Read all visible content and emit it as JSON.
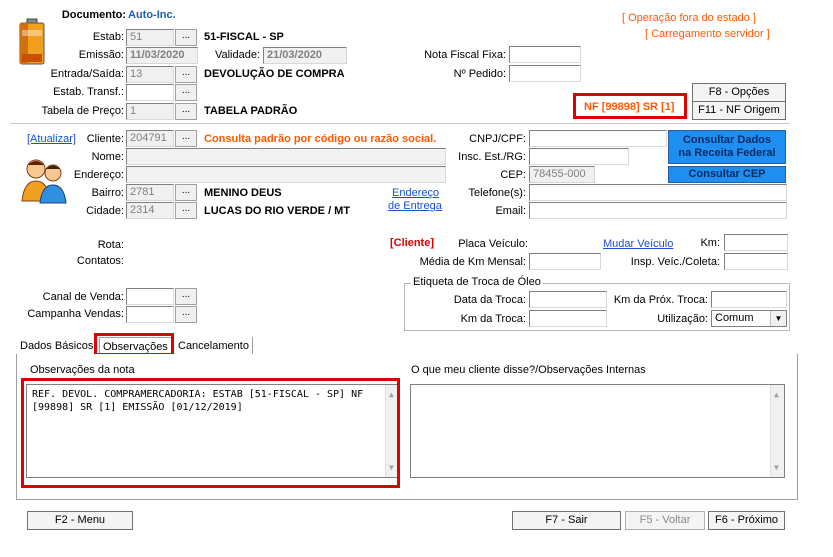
{
  "header": {
    "documento_label": "Documento:",
    "documento_value": "Auto-Inc.",
    "status_1": "[ Operação fora do estado ]",
    "status_2": "[ Carregamento servidor ]",
    "estab_label": "Estab:",
    "estab_value": "51",
    "estab_desc": "51-FISCAL - SP",
    "emissao_label": "Emissão:",
    "emissao_value": "11/03/2020",
    "validade_label": "Validade:",
    "validade_value": "21/03/2020",
    "entrada_label": "Entrada/Saída:",
    "entrada_value": "13",
    "entrada_desc": "DEVOLUÇÃO DE COMPRA",
    "estab_transf_label": "Estab. Transf.:",
    "tabela_label": "Tabela de Preço:",
    "tabela_value": "1",
    "tabela_desc": "TABELA PADRÃO",
    "nf_fixa_label": "Nota Fiscal Fixa:",
    "pedido_label": "Nº Pedido:",
    "nf_ref": "NF [99898] SR [1]",
    "f8_btn": "F8 - Opções",
    "f11_btn": "F11 - NF Origem",
    "dots": "..."
  },
  "cliente": {
    "atualizar": "[Atualizar]",
    "cliente_label": "Cliente:",
    "cliente_value": "204791",
    "consulta_hint": "Consulta padrão por código ou razão social.",
    "nome_label": "Nome:",
    "endereco_label": "Endereço:",
    "bairro_label": "Bairro:",
    "bairro_code": "2781",
    "bairro_desc": "MENINO DEUS",
    "cidade_label": "Cidade:",
    "cidade_code": "2314",
    "cidade_desc": "LUCAS DO RIO VERDE / MT",
    "endereco_entrega_1": "Endereço",
    "endereco_entrega_2": "de Entrega",
    "cnpj_label": "CNPJ/CPF:",
    "insc_label": "Insc. Est./RG:",
    "cep_label": "CEP:",
    "cep_value": "78455-000",
    "telefone_label": "Telefone(s):",
    "email_label": "Email:",
    "consultar_dados_1": "Consultar Dados",
    "consultar_dados_2": "na Receita Federal",
    "consultar_cep": "Consultar CEP"
  },
  "extra": {
    "rota_label": "Rota:",
    "contatos_label": "Contatos:",
    "cliente_tag": "[Cliente]",
    "placa_label": "Placa Veículo:",
    "mudar_veiculo": "Mudar Veículo",
    "km_label": "Km:",
    "media_km_label": "Média de Km Mensal:",
    "insp_label": "Insp. Veíc./Coleta:",
    "canal_label": "Canal de Venda:",
    "campanha_label": "Campanha Vendas:",
    "troca_title": "Etiqueta de Troca de Óleo",
    "data_troca_label": "Data da Troca:",
    "km_prox_label": "Km da Próx. Troca:",
    "km_troca_label": "Km da Troca:",
    "utilizacao_label": "Utilização:",
    "utilizacao_value": "Comum"
  },
  "tabs": [
    {
      "label": "Dados Básicos"
    },
    {
      "label": "Observações"
    },
    {
      "label": "Cancelamento"
    }
  ],
  "obs": {
    "nota_label": "Observações da nota",
    "nota_line1": "REF. DEVOL. COMPRAMERCADORIA: ESTAB [51-FISCAL - SP] NF",
    "nota_line2": "[99898] SR [1] EMISSÃO [01/12/2019]",
    "internas_label": "O que meu cliente disse?/Observações Internas"
  },
  "footer": {
    "f2": "F2 - Menu",
    "f7": "F7 - Sair",
    "f5": "F5 - Voltar",
    "f6": "F6 - Próximo"
  },
  "icons": {
    "battery": "battery-icon",
    "people": "people-icon"
  },
  "colors": {
    "accent_blue": "#1e8ff0",
    "status_orange": "#ff5a00",
    "highlight_red": "#e00000"
  }
}
